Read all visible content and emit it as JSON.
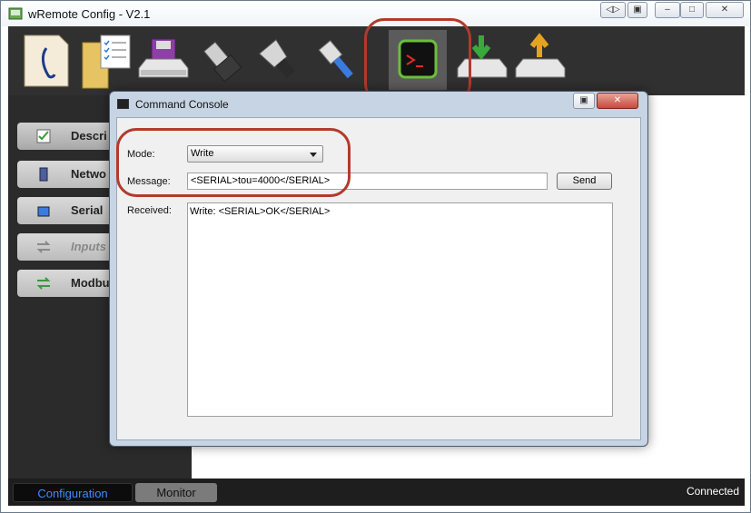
{
  "window": {
    "title": "wRemote Config - V2.1"
  },
  "toolbar": {
    "tools": [
      {
        "name": "description-document-icon"
      },
      {
        "name": "folder-checklist-icon"
      },
      {
        "name": "drive-save-icon"
      },
      {
        "name": "usb-connector-icon"
      },
      {
        "name": "serial-cable-icon"
      },
      {
        "name": "network-cable-icon"
      },
      {
        "name": "command-console-icon"
      },
      {
        "name": "download-drive-icon"
      },
      {
        "name": "upload-drive-icon"
      }
    ],
    "active_index": 6
  },
  "sidebar": {
    "items": [
      {
        "label": "Descri",
        "state": "selected"
      },
      {
        "label": "Netwo",
        "state": "normal"
      },
      {
        "label": "Serial",
        "state": "normal"
      },
      {
        "label": "Inputs",
        "state": "disabled"
      },
      {
        "label": "Modbu",
        "state": "normal"
      }
    ]
  },
  "dialog": {
    "title": "Command Console",
    "mode_label": "Mode:",
    "mode_value": "Write",
    "message_label": "Message:",
    "message_value": "<SERIAL>tou=4000</SERIAL>",
    "send_label": "Send",
    "received_label": "Received:",
    "received_value": "Write: <SERIAL>OK</SERIAL>"
  },
  "statusbar": {
    "tabs": [
      {
        "label": "Configuration",
        "active": true
      },
      {
        "label": "Monitor",
        "active": false
      }
    ],
    "status": "Connected"
  },
  "colors": {
    "highlight": "#b23a2c",
    "active_tab_text": "#3c8cff",
    "toolbar_bg": "#303030"
  }
}
